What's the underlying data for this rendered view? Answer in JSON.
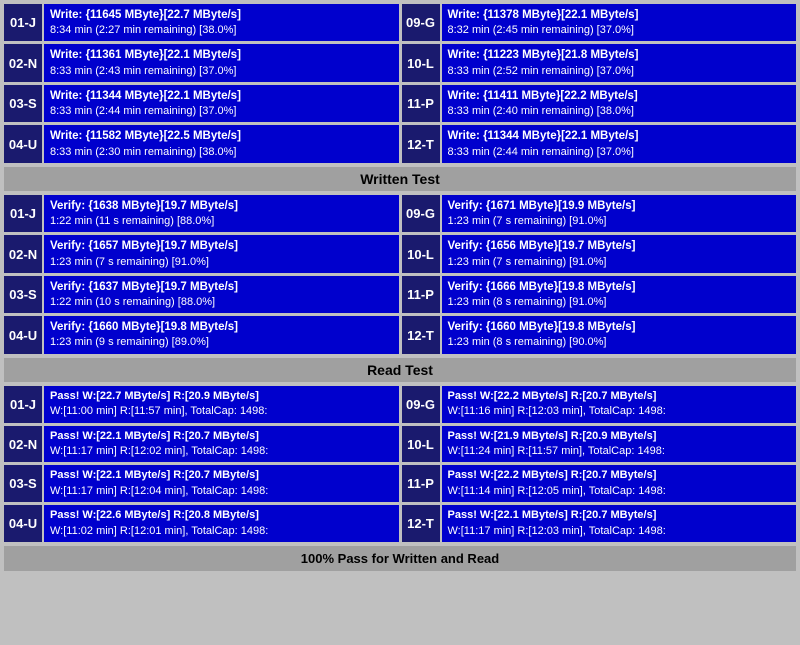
{
  "sections": {
    "write": {
      "left": [
        {
          "id": "01-J",
          "line1": "Write: {11645 MByte}[22.7 MByte/s]",
          "line2": "8:34 min (2:27 min remaining)  [38.0%]"
        },
        {
          "id": "02-N",
          "line1": "Write: {11361 MByte}[22.1 MByte/s]",
          "line2": "8:33 min (2:43 min remaining)  [37.0%]"
        },
        {
          "id": "03-S",
          "line1": "Write: {11344 MByte}[22.1 MByte/s]",
          "line2": "8:33 min (2:44 min remaining)  [37.0%]"
        },
        {
          "id": "04-U",
          "line1": "Write: {11582 MByte}[22.5 MByte/s]",
          "line2": "8:33 min (2:30 min remaining)  [38.0%]"
        }
      ],
      "right": [
        {
          "id": "09-G",
          "line1": "Write: {11378 MByte}[22.1 MByte/s]",
          "line2": "8:32 min (2:45 min remaining)  [37.0%]"
        },
        {
          "id": "10-L",
          "line1": "Write: {11223 MByte}[21.8 MByte/s]",
          "line2": "8:33 min (2:52 min remaining)  [37.0%]"
        },
        {
          "id": "11-P",
          "line1": "Write: {11411 MByte}[22.2 MByte/s]",
          "line2": "8:33 min (2:40 min remaining)  [38.0%]"
        },
        {
          "id": "12-T",
          "line1": "Write: {11344 MByte}[22.1 MByte/s]",
          "line2": "8:33 min (2:44 min remaining)  [37.0%]"
        }
      ],
      "header": "Written Test"
    },
    "verify": {
      "left": [
        {
          "id": "01-J",
          "line1": "Verify: {1638 MByte}[19.7 MByte/s]",
          "line2": "1:22 min (11 s remaining)   [88.0%]"
        },
        {
          "id": "02-N",
          "line1": "Verify: {1657 MByte}[19.7 MByte/s]",
          "line2": "1:23 min (7 s remaining)   [91.0%]"
        },
        {
          "id": "03-S",
          "line1": "Verify: {1637 MByte}[19.7 MByte/s]",
          "line2": "1:22 min (10 s remaining)   [88.0%]"
        },
        {
          "id": "04-U",
          "line1": "Verify: {1660 MByte}[19.8 MByte/s]",
          "line2": "1:23 min (9 s remaining)   [89.0%]"
        }
      ],
      "right": [
        {
          "id": "09-G",
          "line1": "Verify: {1671 MByte}[19.9 MByte/s]",
          "line2": "1:23 min (7 s remaining)   [91.0%]"
        },
        {
          "id": "10-L",
          "line1": "Verify: {1656 MByte}[19.7 MByte/s]",
          "line2": "1:23 min (7 s remaining)   [91.0%]"
        },
        {
          "id": "11-P",
          "line1": "Verify: {1666 MByte}[19.8 MByte/s]",
          "line2": "1:23 min (8 s remaining)   [91.0%]"
        },
        {
          "id": "12-T",
          "line1": "Verify: {1660 MByte}[19.8 MByte/s]",
          "line2": "1:23 min (8 s remaining)   [90.0%]"
        }
      ],
      "header": "Read Test"
    },
    "readtest": {
      "left": [
        {
          "id": "01-J",
          "line1": "Pass! W:[22.7 MByte/s] R:[20.9 MByte/s]",
          "line2": "W:[11:00 min] R:[11:57 min], TotalCap: 1498:"
        },
        {
          "id": "02-N",
          "line1": "Pass! W:[22.1 MByte/s] R:[20.7 MByte/s]",
          "line2": "W:[11:17 min] R:[12:02 min], TotalCap: 1498:"
        },
        {
          "id": "03-S",
          "line1": "Pass! W:[22.1 MByte/s] R:[20.7 MByte/s]",
          "line2": "W:[11:17 min] R:[12:04 min], TotalCap: 1498:"
        },
        {
          "id": "04-U",
          "line1": "Pass! W:[22.6 MByte/s] R:[20.8 MByte/s]",
          "line2": "W:[11:02 min] R:[12:01 min], TotalCap: 1498:"
        }
      ],
      "right": [
        {
          "id": "09-G",
          "line1": "Pass! W:[22.2 MByte/s] R:[20.7 MByte/s]",
          "line2": "W:[11:16 min] R:[12:03 min], TotalCap: 1498:"
        },
        {
          "id": "10-L",
          "line1": "Pass! W:[21.9 MByte/s] R:[20.9 MByte/s]",
          "line2": "W:[11:24 min] R:[11:57 min], TotalCap: 1498:"
        },
        {
          "id": "11-P",
          "line1": "Pass! W:[22.2 MByte/s] R:[20.7 MByte/s]",
          "line2": "W:[11:14 min] R:[12:05 min], TotalCap: 1498:"
        },
        {
          "id": "12-T",
          "line1": "Pass! W:[22.1 MByte/s] R:[20.7 MByte/s]",
          "line2": "W:[11:17 min] R:[12:03 min], TotalCap: 1498:"
        }
      ],
      "header": "Read Test"
    }
  },
  "bottom_status": "100% Pass for Written and Read"
}
